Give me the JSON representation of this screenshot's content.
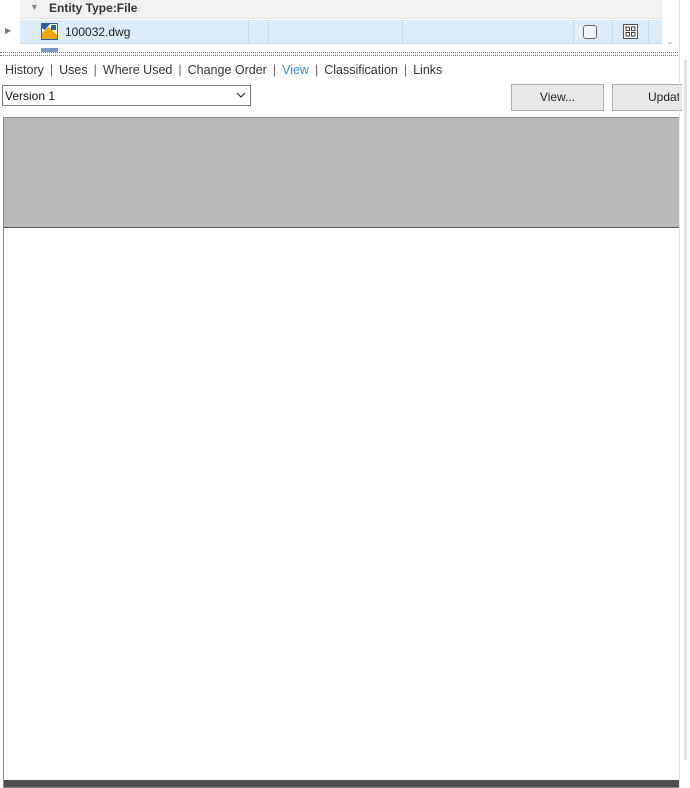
{
  "grid": {
    "group_label": "Entity Type:File",
    "rows": [
      {
        "name": "100032.dwg"
      }
    ]
  },
  "tabs": [
    {
      "label": "History",
      "active": false
    },
    {
      "label": "Uses",
      "active": false
    },
    {
      "label": "Where Used",
      "active": false
    },
    {
      "label": "Change Order",
      "active": false
    },
    {
      "label": "View",
      "active": true
    },
    {
      "label": "Classification",
      "active": false
    },
    {
      "label": "Links",
      "active": false
    }
  ],
  "version_select": {
    "value": "Version 1"
  },
  "buttons": {
    "view": "View...",
    "update": "Updat"
  },
  "colors": {
    "active_tab": "#2a8fd6",
    "selected_row": "#dcecf9",
    "viewer_header": "#bababa",
    "viewer_footer": "#4e4e4e"
  },
  "icons": {
    "group_toggle": "triangle-down-icon",
    "row_expander": "triangle-right-icon",
    "file": "dwg-file-icon",
    "checkbox": "checkbox-icon",
    "thumbnail": "grid-view-icon",
    "dropdown": "chevron-down-icon"
  }
}
